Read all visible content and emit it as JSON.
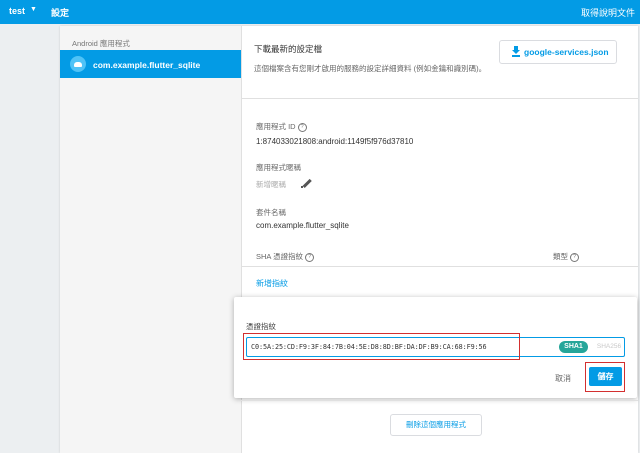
{
  "topbar": {
    "project": "test",
    "page_title": "設定",
    "docs_link": "取得說明文件"
  },
  "sidebar": {
    "section_title": "Android 應用程式",
    "selected_app": "com.example.flutter_sqlite"
  },
  "download": {
    "title": "下載最新的設定檔",
    "description": "這個檔案含有您剛才啟用的服務的設定詳細資料 (例如金鑰和識別碼)。",
    "button_label": "google-services.json"
  },
  "app_id": {
    "label": "應用程式 ID",
    "value": "1:874033021808:android:1149f5f976d37810"
  },
  "app_nickname": {
    "label": "應用程式暱稱",
    "placeholder": "新增暱稱"
  },
  "package_name": {
    "label": "套件名稱",
    "value": "com.example.flutter_sqlite"
  },
  "sha_table": {
    "col_fingerprint": "SHA 憑證指紋",
    "col_type": "類型"
  },
  "add_fingerprint_link": "新增指紋",
  "dialog": {
    "field_label": "憑證指紋",
    "fingerprint_value": "C0:5A:25:CD:F9:3F:84:7B:04:5E:D8:8D:BF:DA:DF:B9:CA:68:F9:56",
    "chip_selected": "SHA1",
    "chip_other": "SHA256",
    "cancel_label": "取消",
    "save_label": "儲存"
  },
  "delete_app_label": "刪除這個應用程式",
  "colors": {
    "brand_blue": "#039be5",
    "sha1_chip": "#26a69a",
    "highlight_red": "#d32f2f"
  }
}
